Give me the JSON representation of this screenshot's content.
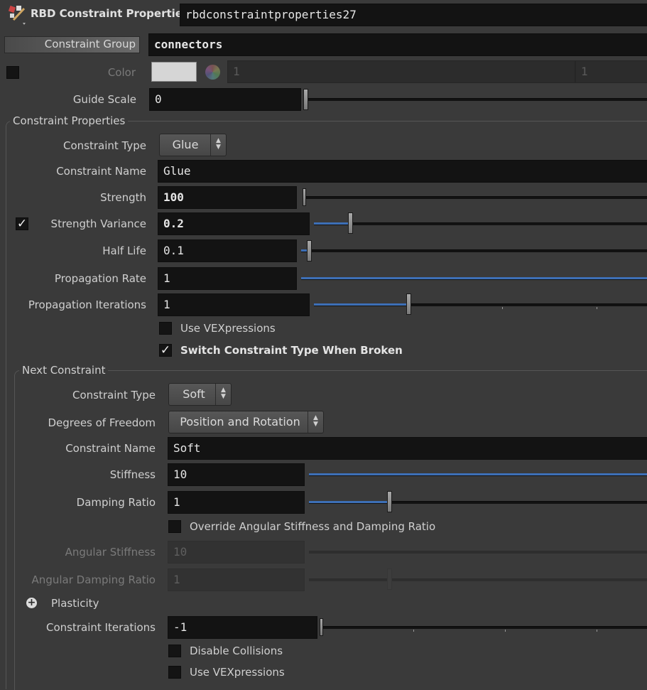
{
  "header": {
    "node_type": "RBD Constraint Properties",
    "node_name": "rbdconstraintproperties27",
    "icon": "rbd-node-icon"
  },
  "constraint_group": {
    "label": "Constraint Group",
    "value": "connectors"
  },
  "color": {
    "label": "Color",
    "swatch": "#d6d6d6",
    "r": "1",
    "g": "1"
  },
  "guide_scale": {
    "label": "Guide Scale",
    "value": "0",
    "slider_fraction": 0.0
  },
  "constraint_properties": {
    "title": "Constraint Properties",
    "constraint_type": {
      "label": "Constraint Type",
      "value": "Glue"
    },
    "constraint_name": {
      "label": "Constraint Name",
      "value": "Glue"
    },
    "strength": {
      "label": "Strength",
      "value": "100",
      "slider_fraction": 0.0
    },
    "strength_variance": {
      "label": "Strength Variance",
      "value": "0.2",
      "checked": true,
      "slider_fraction": 0.2
    },
    "half_life": {
      "label": "Half Life",
      "value": "0.1",
      "slider_fraction": 0.02
    },
    "propagation_rate": {
      "label": "Propagation Rate",
      "value": "1",
      "slider_fraction": 1.0
    },
    "propagation_iterations": {
      "label": "Propagation Iterations",
      "value": "1",
      "slider_fraction": 0.25
    },
    "use_vexpressions": {
      "label": "Use VEXpressions",
      "checked": false
    },
    "switch_type": {
      "label": "Switch Constraint Type When Broken",
      "checked": true
    }
  },
  "next_constraint": {
    "title": "Next Constraint",
    "constraint_type": {
      "label": "Constraint Type",
      "value": "Soft"
    },
    "degrees_of_freedom": {
      "label": "Degrees of Freedom",
      "value": "Position and Rotation"
    },
    "constraint_name": {
      "label": "Constraint Name",
      "value": "Soft"
    },
    "stiffness": {
      "label": "Stiffness",
      "value": "10",
      "slider_fraction": 1.0
    },
    "damping_ratio": {
      "label": "Damping Ratio",
      "value": "1",
      "slider_fraction": 0.24
    },
    "override_angular": {
      "label": "Override Angular Stiffness and Damping Ratio",
      "checked": false
    },
    "angular_stiffness": {
      "label": "Angular Stiffness",
      "value": "10"
    },
    "angular_damping_ratio": {
      "label": "Angular Damping Ratio",
      "value": "1"
    },
    "plasticity": {
      "label": "Plasticity",
      "icon": "plus-circle-icon"
    },
    "constraint_iterations": {
      "label": "Constraint Iterations",
      "value": "-1",
      "slider_fraction": 0.0
    },
    "disable_collisions": {
      "label": "Disable Collisions",
      "checked": false
    },
    "use_vexpressions": {
      "label": "Use VEXpressions",
      "checked": false
    }
  },
  "colors": {
    "background": "#3a3a3a",
    "field": "#131313",
    "slider_fill": "#3d6fb6",
    "text": "#d0d0d0"
  }
}
